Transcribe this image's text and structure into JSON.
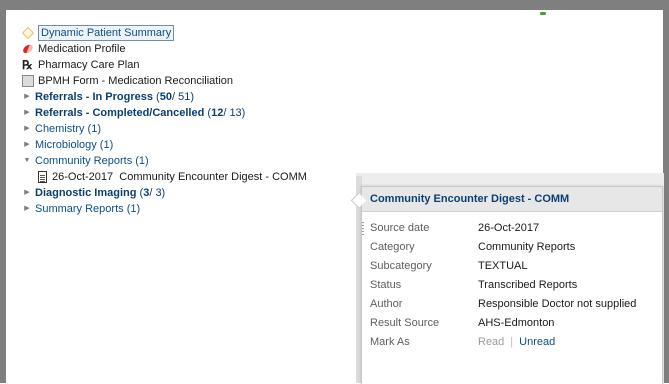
{
  "tree": {
    "dynamic_summary": "Dynamic Patient Summary",
    "medication_profile": "Medication Profile",
    "pharmacy_care_plan": "Pharmacy Care Plan",
    "bpmh": "BPMH Form - Medication Reconciliation",
    "referrals_in_progress": {
      "label": "Referrals - In Progress",
      "count": "50",
      "total": " / 51)"
    },
    "referrals_completed": {
      "label": "Referrals - Completed/Cancelled",
      "count": "12",
      "total": " / 13)"
    },
    "chemistry": "Chemistry (1)",
    "microbiology": "Microbiology (1)",
    "community_reports": "Community Reports (1)",
    "community_item": {
      "date": "26-Oct-2017",
      "title": "Community Encounter Digest - COMM"
    },
    "diagnostic_imaging": {
      "label": "Diagnostic Imaging",
      "count": "3",
      "total": " / 3)"
    },
    "summary_reports": "Summary Reports (1)"
  },
  "popup": {
    "title": "Community Encounter Digest - COMM",
    "rows": [
      {
        "key": "Source date",
        "value": "26-Oct-2017"
      },
      {
        "key": "Category",
        "value": "Community Reports"
      },
      {
        "key": "Subcategory",
        "value": "TEXTUAL"
      },
      {
        "key": "Status",
        "value": "Transcribed Reports"
      },
      {
        "key": "Author",
        "value": "Responsible Doctor not supplied"
      },
      {
        "key": "Result Source",
        "value": "AHS-Edmonton"
      }
    ],
    "mark_as": {
      "key": "Mark As",
      "read": "Read",
      "separator": "|",
      "unread": "Unread"
    }
  },
  "icons": {
    "dynamic_summary": "diamond-icon",
    "medication_profile": "pill-icon",
    "pharmacy_care_plan": "rx-icon",
    "bpmh": "form-icon",
    "collapsed": "triangle-right-icon",
    "expanded": "triangle-down-icon",
    "document": "document-icon"
  },
  "colors": {
    "link": "#0b4f8a",
    "bold_link": "#0b3f73",
    "frame": "#7f7f7f"
  }
}
